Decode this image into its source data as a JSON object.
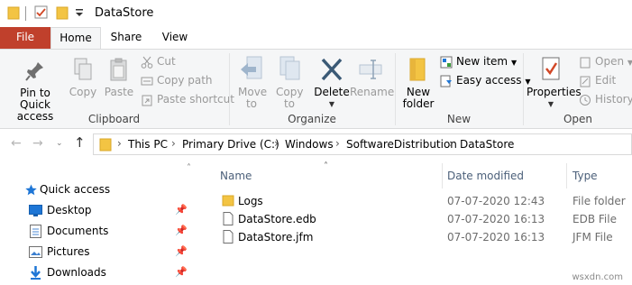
{
  "window": {
    "title": "DataStore"
  },
  "tabs": {
    "file": "File",
    "home": "Home",
    "share": "Share",
    "view": "View"
  },
  "ribbon": {
    "clipboard": {
      "label": "Clipboard",
      "pin": "Pin to Quick access",
      "copy": "Copy",
      "paste": "Paste",
      "cut": "Cut",
      "copy_path": "Copy path",
      "paste_shortcut": "Paste shortcut"
    },
    "organize": {
      "label": "Organize",
      "move_to": "Move to",
      "copy_to": "Copy to",
      "delete": "Delete",
      "rename": "Rename"
    },
    "new": {
      "label": "New",
      "new_folder": "New folder",
      "new_item": "New item",
      "easy_access": "Easy access"
    },
    "open": {
      "label": "Open",
      "properties": "Properties",
      "open": "Open",
      "edit": "Edit",
      "history": "History"
    }
  },
  "address": {
    "crumbs": [
      "This PC",
      "Primary Drive (C:)",
      "Windows",
      "SoftwareDistribution",
      "DataStore"
    ]
  },
  "navpane": {
    "items": [
      {
        "label": "Quick access",
        "icon": "star-icon"
      },
      {
        "label": "Desktop",
        "icon": "desktop-icon"
      },
      {
        "label": "Documents",
        "icon": "documents-icon"
      },
      {
        "label": "Pictures",
        "icon": "pictures-icon"
      },
      {
        "label": "Downloads",
        "icon": "downloads-icon"
      }
    ]
  },
  "filelist": {
    "columns": {
      "name": "Name",
      "date": "Date modified",
      "type": "Type"
    },
    "rows": [
      {
        "name": "Logs",
        "date": "07-07-2020 12:43",
        "type": "File folder",
        "icon": "folder-icon"
      },
      {
        "name": "DataStore.edb",
        "date": "07-07-2020 16:13",
        "type": "EDB File",
        "icon": "file-icon"
      },
      {
        "name": "DataStore.jfm",
        "date": "07-07-2020 16:13",
        "type": "JFM File",
        "icon": "file-icon"
      }
    ]
  },
  "watermark": "wsxdn.com",
  "colors": {
    "file_tab": "#c0402c",
    "folder": "#f3c443",
    "accent": "#1e76d6"
  }
}
